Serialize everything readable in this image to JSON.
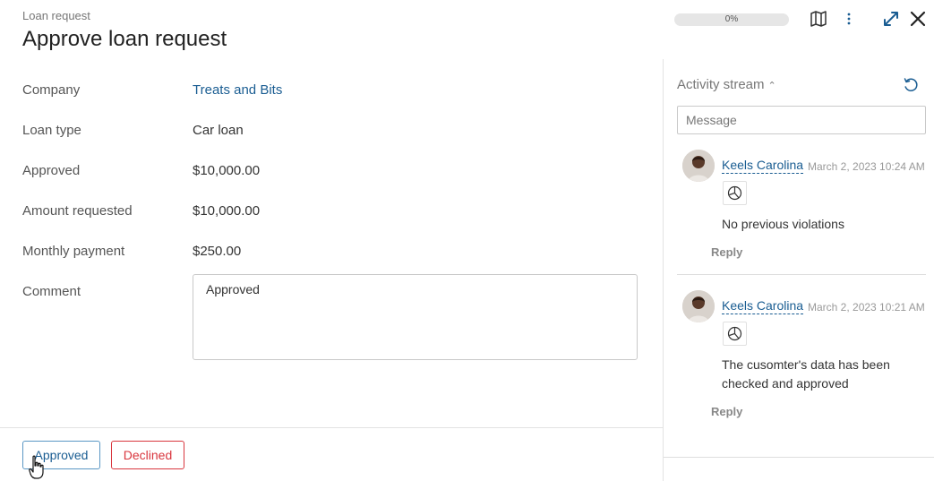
{
  "header": {
    "breadcrumb": "Loan request",
    "title": "Approve loan request",
    "progress": "0%",
    "progress_value": 0,
    "icons": [
      "map-icon",
      "more-vertical-icon",
      "expand-icon",
      "close-icon"
    ]
  },
  "form": {
    "fields": [
      {
        "label": "Company",
        "value": "Treats and Bits",
        "is_link": true
      },
      {
        "label": "Loan type",
        "value": "Car loan"
      },
      {
        "label": "Approved",
        "value": "$10,000.00"
      },
      {
        "label": "Amount requested",
        "value": "$10,000.00"
      },
      {
        "label": "Monthly payment",
        "value": "$250.00"
      }
    ],
    "comment_label": "Comment",
    "comment_value": "Approved"
  },
  "buttons": {
    "approved": "Approved",
    "declined": "Declined"
  },
  "activity": {
    "title": "Activity stream",
    "message_placeholder": "Message",
    "posts": [
      {
        "author": "Keels Carolina",
        "time": "March 2, 2023 10:24 AM",
        "text": "No previous violations",
        "reply": "Reply"
      },
      {
        "author": "Keels Carolina",
        "time": "March 2, 2023 10:21 AM",
        "text": "The cusomter's data has been checked and approved",
        "reply": "Reply"
      }
    ]
  },
  "colors": {
    "link": "#1a5d92",
    "approve_border": "#5a97c4",
    "decline": "#d9363e"
  }
}
